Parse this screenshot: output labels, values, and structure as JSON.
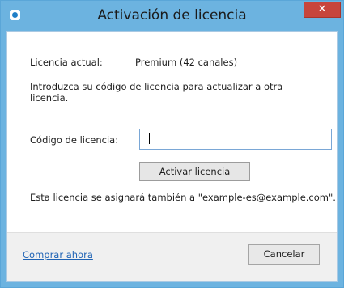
{
  "window": {
    "title": "Activación de licencia",
    "close_glyph": "✕",
    "accent_color": "#6cb3e0"
  },
  "license": {
    "current_label": "Licencia actual:",
    "current_value": "Premium (42 canales)"
  },
  "instructions": "Introduzca su código de licencia para actualizar a otra licencia.",
  "code_field": {
    "label": "Código de licencia:",
    "value": ""
  },
  "activate_button": "Activar licencia",
  "assign_note": "Esta licencia se asignará también a \"example-es@example.com\".",
  "footer": {
    "buy_link": "Comprar ahora",
    "cancel_button": "Cancelar"
  }
}
